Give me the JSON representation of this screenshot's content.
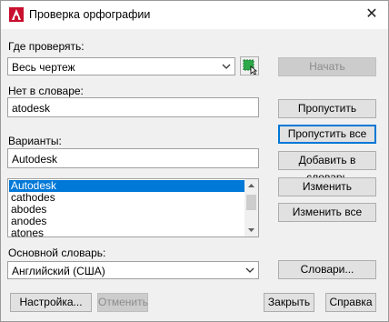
{
  "window": {
    "title": "Проверка орфографии",
    "close_glyph": "✕",
    "accent_color": "#0078d7",
    "app_icon_color": "#c8102e"
  },
  "where": {
    "label": "Где проверять:",
    "value": "Весь чертеж"
  },
  "not_in_dict": {
    "label": "Нет в словаре:",
    "value": "atodesk"
  },
  "suggestions": {
    "label": "Варианты:",
    "value": "Autodesk",
    "items": [
      "Autodesk",
      "cathodes",
      "abodes",
      "anodes",
      "atones"
    ],
    "selected_index": 0
  },
  "main_dict": {
    "label": "Основной словарь:",
    "value": "Английский (США)"
  },
  "buttons": {
    "start": "Начать",
    "ignore": "Пропустить",
    "ignore_all": "Пропустить все",
    "add": "Добавить в словарь",
    "change": "Изменить",
    "change_all": "Изменить все",
    "dictionaries": "Словари...",
    "settings": "Настройка...",
    "undo": "Отменить",
    "close": "Закрыть",
    "help": "Справка"
  }
}
